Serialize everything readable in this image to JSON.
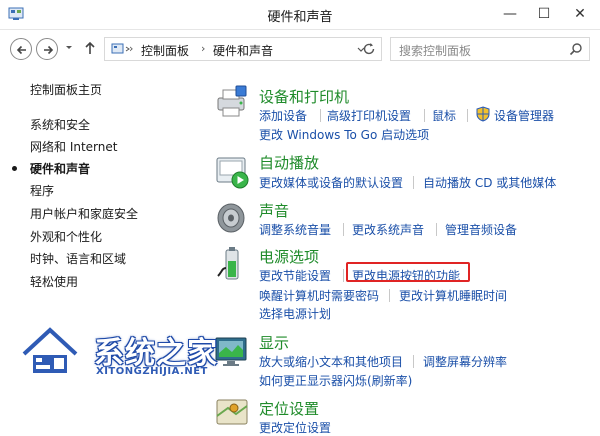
{
  "window": {
    "title": "硬件和声音",
    "controls": {
      "minimize": "—",
      "maximize": "☐",
      "close": "✕"
    }
  },
  "nav": {
    "breadcrumb": [
      "控制面板",
      "硬件和声音"
    ],
    "separator": "›",
    "search_placeholder": "搜索控制面板"
  },
  "sidebar": {
    "items": [
      {
        "label": "控制面板主页",
        "current": false
      },
      {
        "label": "系统和安全",
        "current": false
      },
      {
        "label": "网络和 Internet",
        "current": false
      },
      {
        "label": "硬件和声音",
        "current": true
      },
      {
        "label": "程序",
        "current": false
      },
      {
        "label": "用户帐户和家庭安全",
        "current": false
      },
      {
        "label": "外观和个性化",
        "current": false
      },
      {
        "label": "时钟、语言和区域",
        "current": false
      },
      {
        "label": "轻松使用",
        "current": false
      }
    ]
  },
  "categories": [
    {
      "title": "设备和打印机",
      "icon": "printer-icon",
      "links": [
        [
          "添加设备",
          "高级打印机设置",
          "鼠标",
          "设备管理器"
        ],
        [
          "更改 Windows To Go 启动选项"
        ]
      ]
    },
    {
      "title": "自动播放",
      "icon": "autoplay-icon",
      "links": [
        [
          "更改媒体或设备的默认设置",
          "自动播放 CD 或其他媒体"
        ]
      ]
    },
    {
      "title": "声音",
      "icon": "speaker-icon",
      "links": [
        [
          "调整系统音量",
          "更改系统声音",
          "管理音频设备"
        ]
      ]
    },
    {
      "title": "电源选项",
      "icon": "battery-icon",
      "links": [
        [
          "更改节能设置",
          "更改电源按钮的功能"
        ],
        [
          "唤醒计算机时需要密码",
          "更改计算机睡眠时间"
        ],
        [
          "选择电源计划"
        ]
      ]
    },
    {
      "title": "显示",
      "icon": "display-icon",
      "links": [
        [
          "放大或缩小文本和其他项目",
          "调整屏幕分辨率"
        ],
        [
          "如何更正显示器闪烁(刷新率)"
        ]
      ]
    },
    {
      "title": "定位设置",
      "icon": "location-icon",
      "links": [
        [
          "更改定位设置"
        ]
      ]
    }
  ],
  "watermark": {
    "text": "系统之家",
    "url": "XITONGZHIJIA.NET"
  },
  "colors": {
    "category_title": "#1f8b2a",
    "link": "#1a4fa8",
    "highlight": "#e02424"
  }
}
